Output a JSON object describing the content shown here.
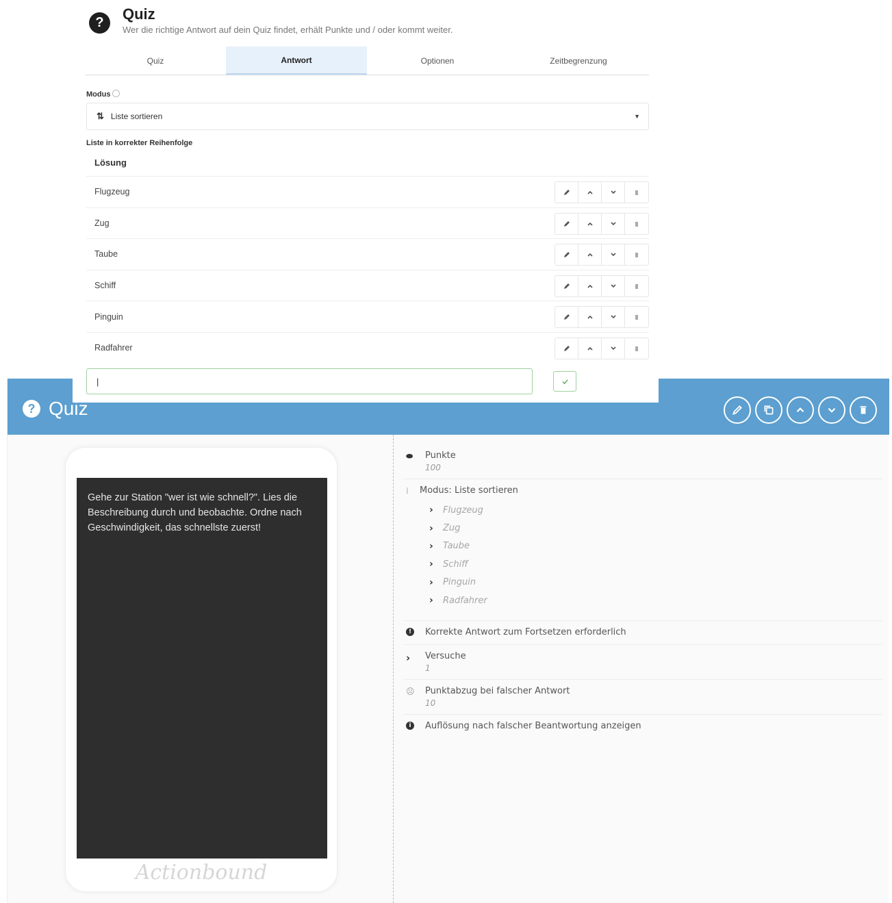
{
  "editor": {
    "title": "Quiz",
    "subtitle": "Wer die richtige Antwort auf dein Quiz findet, erhält Punkte und / oder kommt weiter.",
    "tabs": [
      {
        "label": "Quiz"
      },
      {
        "label": "Antwort"
      },
      {
        "label": "Optionen"
      },
      {
        "label": "Zeitbegrenzung"
      }
    ],
    "active_tab": "Antwort",
    "mode_label": "Modus",
    "mode_value": "Liste sortieren",
    "list_label": "Liste in korrekter Reihenfolge",
    "column_header": "Lösung",
    "rows": [
      {
        "text": "Flugzeug"
      },
      {
        "text": "Zug"
      },
      {
        "text": "Taube"
      },
      {
        "text": "Schiff"
      },
      {
        "text": "Pinguin"
      },
      {
        "text": "Radfahrer"
      }
    ],
    "new_entry_value": "|",
    "confirm_icon": "check-icon"
  },
  "bound": {
    "header_title": "Quiz",
    "header_color": "#5c9fd0",
    "actions": [
      {
        "name": "edit-button",
        "icon": "pencil-icon"
      },
      {
        "name": "duplicate-button",
        "icon": "copy-icon"
      },
      {
        "name": "move-up-button",
        "icon": "chevron-up-icon"
      },
      {
        "name": "move-down-button",
        "icon": "chevron-down-icon"
      },
      {
        "name": "delete-button",
        "icon": "trash-icon"
      }
    ],
    "phone_text": "Gehe zur Station \"wer ist wie schnell?\". Lies die Beschreibung durch und beobachte. Ordne nach Geschwindigkeit, das schnellste zuerst!",
    "brand": "Actionbound",
    "details": {
      "points_label": "Punkte",
      "points_value": "100",
      "mode_text": "Modus: Liste sortieren",
      "items": [
        "Flugzeug",
        "Zug",
        "Taube",
        "Schiff",
        "Pinguin",
        "Radfahrer"
      ],
      "required_text": "Korrekte Antwort zum Fortsetzen erforderlich",
      "attempts_label": "Versuche",
      "attempts_value": "1",
      "penalty_label": "Punktabzug bei falscher Antwort",
      "penalty_value": "10",
      "show_solution_text": "Auflösung nach falscher Beantwortung anzeigen"
    }
  }
}
